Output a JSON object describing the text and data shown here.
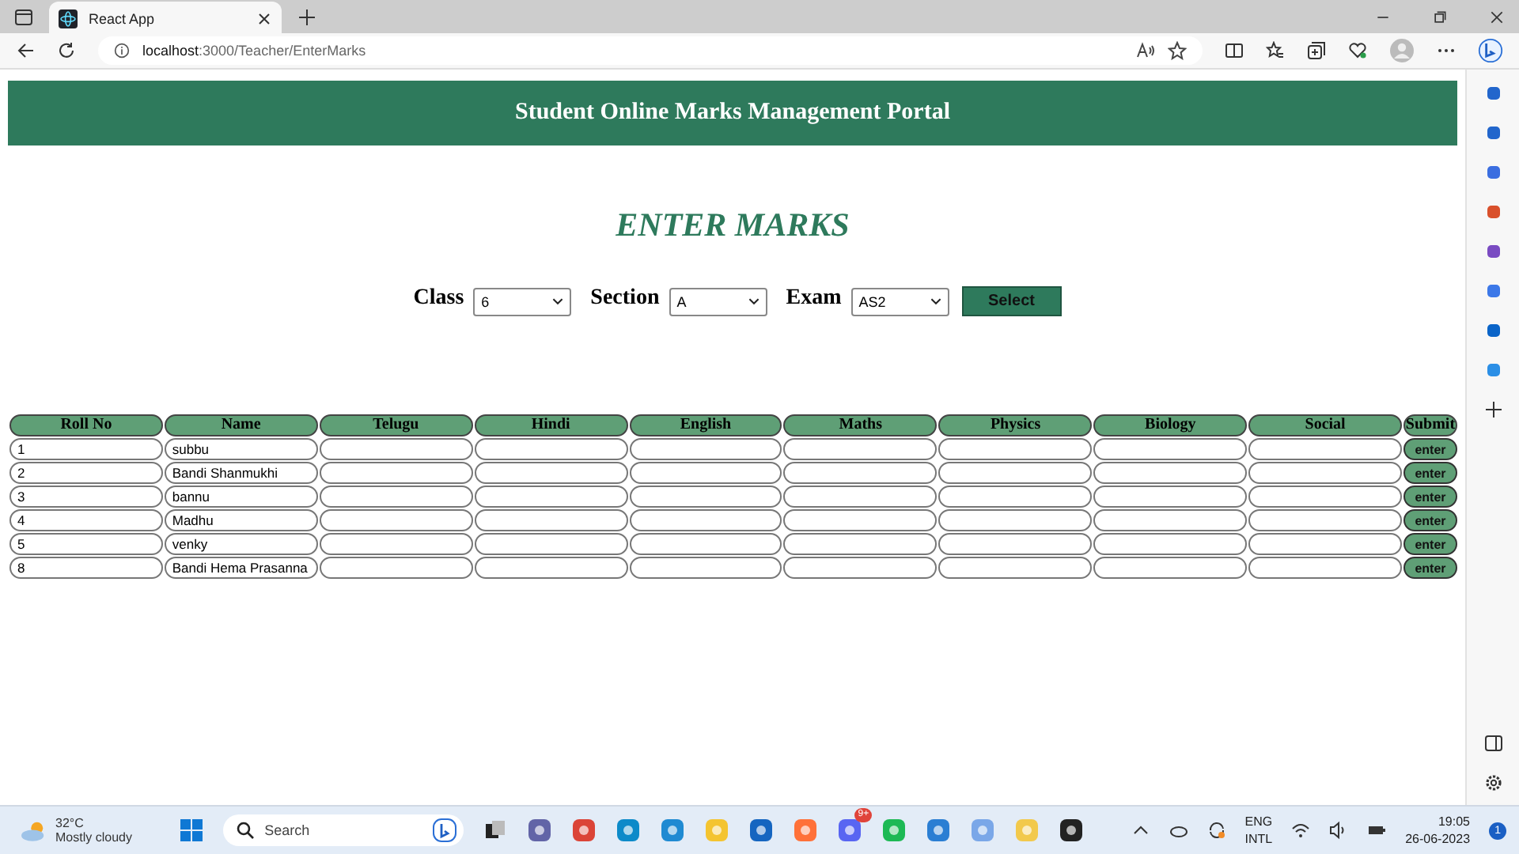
{
  "browser": {
    "tab_title": "React App",
    "url_host": "localhost",
    "url_path": ":3000/Teacher/EnterMarks"
  },
  "page": {
    "header_title": "Student Online Marks Management Portal",
    "heading": "ENTER MARKS",
    "filters": [
      {
        "label": "Class",
        "value": "6"
      },
      {
        "label": "Section",
        "value": "A"
      },
      {
        "label": "Exam",
        "value": "AS2"
      }
    ],
    "select_button": "Select",
    "table": {
      "columns": [
        "Roll No",
        "Name",
        "Telugu",
        "Hindi",
        "English",
        "Maths",
        "Physics",
        "Biology",
        "Social",
        "Submit"
      ],
      "rows": [
        {
          "roll_no": "1",
          "name": "subbu",
          "button": "enter"
        },
        {
          "roll_no": "2",
          "name": "Bandi Shanmukhi",
          "button": "enter"
        },
        {
          "roll_no": "3",
          "name": "bannu",
          "button": "enter"
        },
        {
          "roll_no": "4",
          "name": "Madhu",
          "button": "enter"
        },
        {
          "roll_no": "5",
          "name": "venky",
          "button": "enter"
        },
        {
          "roll_no": "8",
          "name": "Bandi Hema Prasanna",
          "button": "enter"
        }
      ]
    }
  },
  "taskbar": {
    "weather_temp": "32°C",
    "weather_text": "Mostly cloudy",
    "search_placeholder": "Search",
    "discord_badge": "9+",
    "lang_1": "ENG",
    "lang_2": "INTL",
    "time": "19:05",
    "date": "26-06-2023",
    "notification_count": "1"
  }
}
